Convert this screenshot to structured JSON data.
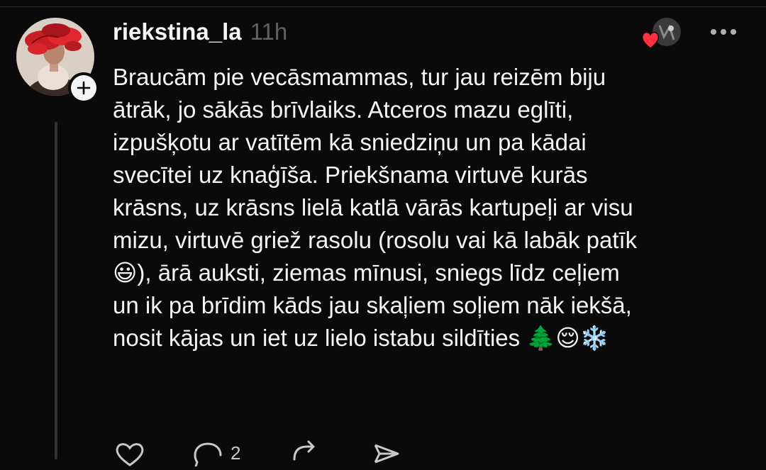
{
  "post": {
    "username": "riekstina_la",
    "timestamp": "11h",
    "text": "Braucām pie vecāsmammas, tur jau reizēm biju\nātrāk, jo sākās brīvlaiks. Atceros mazu eglīti,\nizpušķotu ar vatītēm kā sniedziņu un pa kādai\nsvecītei uz knaģīša. Priekšnama virtuvē kurās\nkrāsns, uz krāsns lielā katlā vārās kartupeļi ar visu\nmizu, virtuvē griež rasolu (rosolu vai kā labāk patīk\n😃), ārā auksti, ziemas mīnusi, sniegs līdz ceļiem\nun ik pa brīdim kāds jau skaļiem soļiem nāk iekšā,\nnosit kājas un iet uz lielo istabu sildīties 🌲😌❄️",
    "reply_count": "2"
  },
  "icons": {
    "follow": "plus-icon",
    "more": "more-horizontal-icon",
    "like": "heart-icon",
    "reply": "comment-icon",
    "repost": "repost-icon",
    "share": "send-icon"
  },
  "colors": {
    "background": "#0a0a0a",
    "text_primary": "#f3f5f7",
    "text_secondary": "#616161",
    "like_heart": "#ff3040",
    "thread_line": "#333333"
  }
}
